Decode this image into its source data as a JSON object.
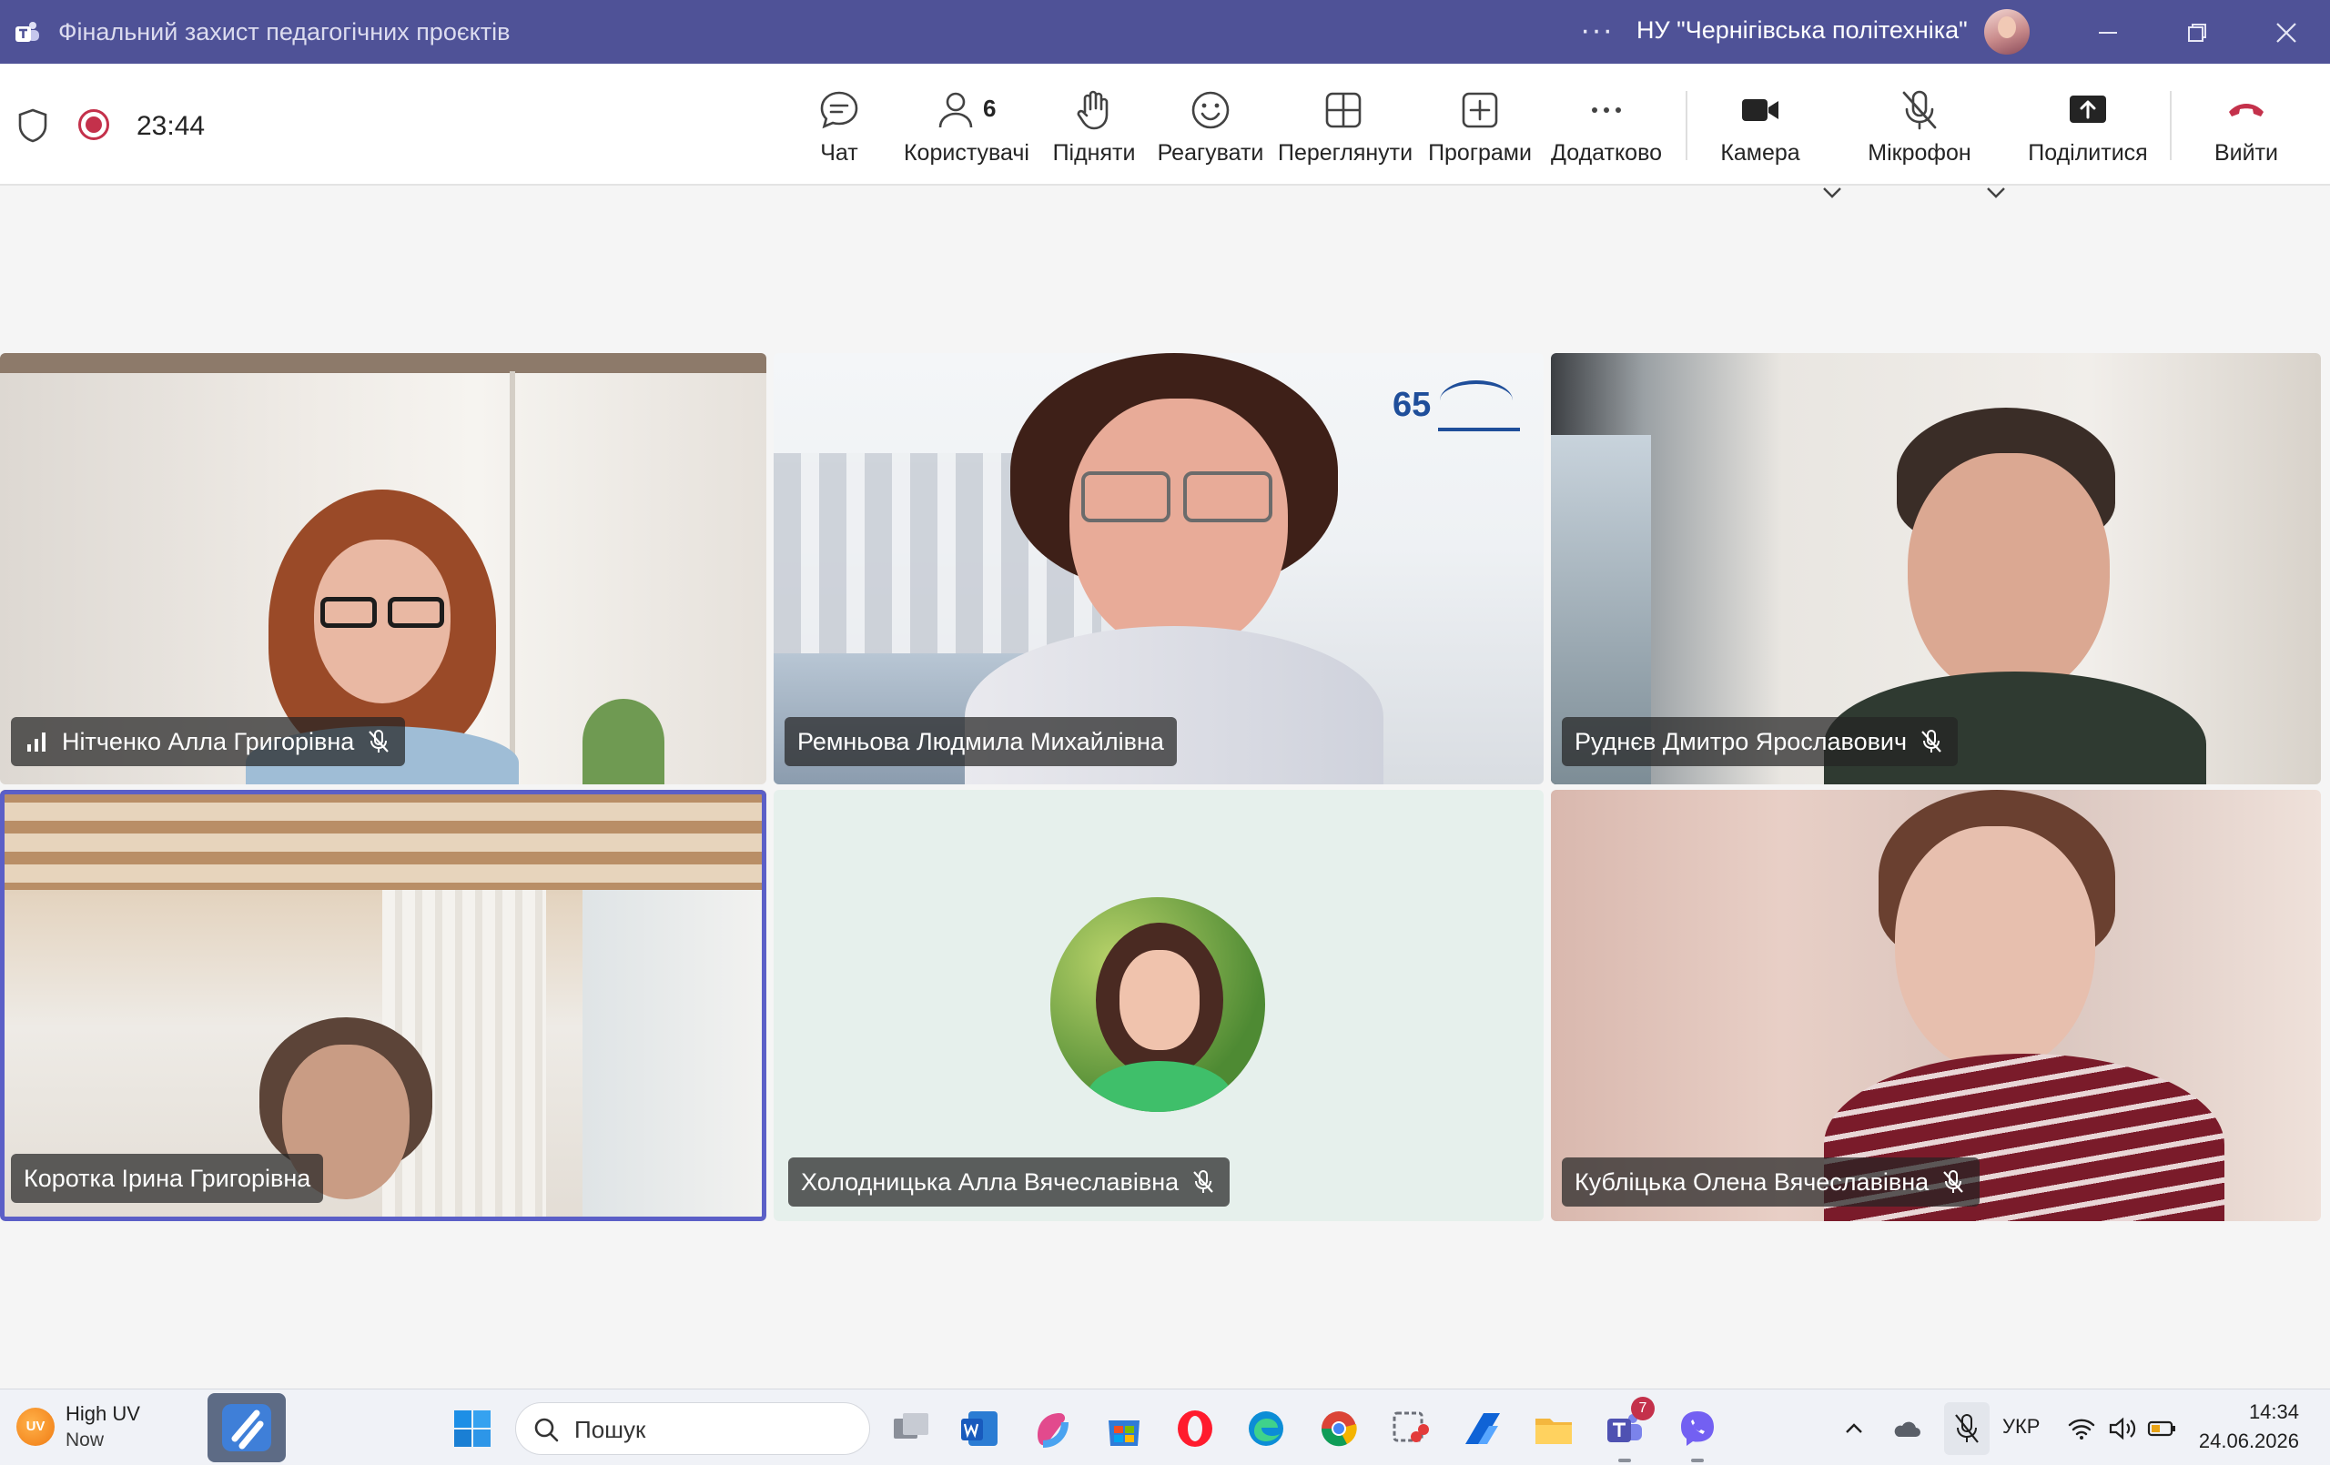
{
  "window": {
    "title": "Фінальний захист педагогічних проєктів",
    "more_menu": "···",
    "org_name": "НУ \"Чернігівська політехніка\""
  },
  "meeting": {
    "elapsed": "23:44",
    "recording": true
  },
  "toolbar": {
    "chat": "Чат",
    "people": "Користувачі",
    "people_count": "6",
    "raise": "Підняти",
    "react": "Реагувати",
    "view": "Переглянути",
    "apps": "Програми",
    "more": "Додатково",
    "camera": "Камера",
    "mic": "Мікрофон",
    "share": "Поділитися",
    "leave": "Вийти"
  },
  "participants": [
    {
      "name": "Нітченко Алла Григорівна",
      "muted": true,
      "video": true,
      "signal_icon": true
    },
    {
      "name": "Ремньова Людмила Михайлівна",
      "muted": false,
      "video": true
    },
    {
      "name": "Руднєв Дмитро Ярославович",
      "muted": true,
      "video": true
    },
    {
      "name": "Коротка Ірина Григорівна",
      "muted": false,
      "video": true,
      "active_speaker": true
    },
    {
      "name": "Холодницька Алла Вячеславівна",
      "muted": true,
      "video": false
    },
    {
      "name": "Кубліцька Олена Вячеславівна",
      "muted": true,
      "video": true
    }
  ],
  "video_overlay": {
    "logo_number": "65"
  },
  "taskbar": {
    "weather_badge": "UV",
    "weather_title": "High UV",
    "weather_sub": "Now",
    "search_placeholder": "Пошук",
    "teams_badge": "7",
    "language": "УКР",
    "time": "14:34",
    "date": "24.06.2026"
  },
  "colors": {
    "titlebar": "#4f5297",
    "accent": "#5b5fc7",
    "leave": "#c4314b",
    "record": "#c4314b"
  }
}
